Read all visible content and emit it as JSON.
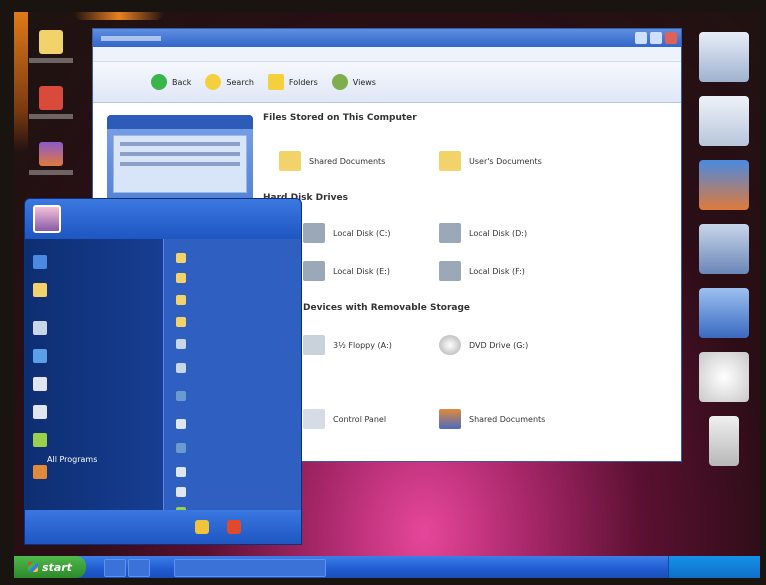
{
  "taskbar": {
    "start_label": "start",
    "clock": ""
  },
  "start_menu": {
    "user_name": "",
    "all_programs": "All Programs",
    "pinned": [
      "",
      "",
      "",
      "",
      "",
      "",
      "",
      "",
      ""
    ],
    "places": [
      "",
      "",
      "",
      "",
      "",
      "",
      "",
      "",
      "",
      "",
      "",
      ""
    ]
  },
  "explorer": {
    "toolbar": [
      {
        "label": "Back",
        "icon": "back-arrow-icon",
        "color": "#39b54a"
      },
      {
        "label": "Search",
        "icon": "search-icon",
        "color": "#f4d03f"
      },
      {
        "label": "Folders",
        "icon": "folders-icon",
        "color": "#f4d03f"
      },
      {
        "label": "Views",
        "icon": "views-icon",
        "color": "#7fae4f"
      }
    ],
    "sections": [
      {
        "title": "Files Stored on This Computer",
        "items": [
          "Shared Documents",
          "User's Documents"
        ]
      },
      {
        "title": "Hard Disk Drives",
        "items": [
          "Local Disk (C:)",
          "Local Disk (D:)",
          "Local Disk (E:)",
          "Local Disk (F:)"
        ]
      },
      {
        "title": "Devices with Removable Storage",
        "items": [
          "3½ Floppy (A:)",
          "DVD Drive (G:)",
          "Control Panel",
          "Shared Documents"
        ]
      }
    ]
  },
  "colors": {
    "folder": "#f2d36b",
    "drive": "#9aa8b8",
    "xp_blue": "#2f5fc0",
    "start_green": "#3aa23a"
  }
}
